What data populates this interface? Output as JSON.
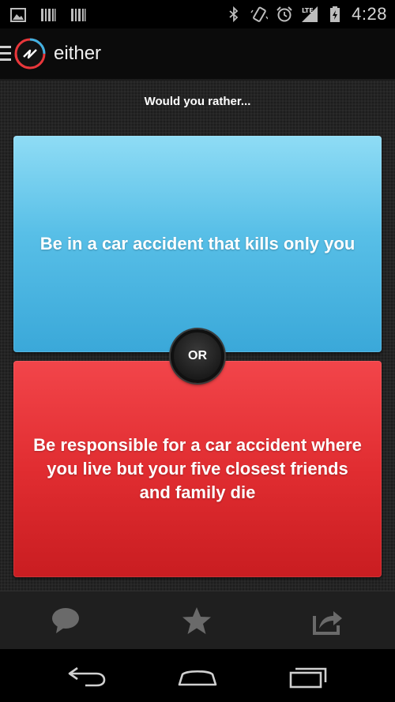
{
  "status_bar": {
    "time": "4:28",
    "left_icons": [
      "image-notification-icon",
      "barcode-notification-icon",
      "barcode-notification-icon"
    ],
    "right_icons": [
      "bluetooth-icon",
      "vibrate-icon",
      "alarm-icon",
      "lte-signal-icon",
      "battery-charging-icon"
    ],
    "network_label": "LTE"
  },
  "action_bar": {
    "title": "either",
    "logo_icon": "either-logo-icon",
    "menu_icon": "hamburger-menu-icon"
  },
  "content": {
    "prompt": "Would you rather...",
    "option_a": "Be in a car accident that kills only you",
    "option_b": "Be responsible for a car accident where you live but your five closest friends and family die",
    "or_label": "OR",
    "colors": {
      "option_a": "#58bfe7",
      "option_b": "#e12d31",
      "background": "#242424"
    }
  },
  "bottom_bar": {
    "icons": [
      "comment-icon",
      "star-icon",
      "share-icon"
    ]
  },
  "nav_bar": {
    "icons": [
      "back-icon",
      "home-icon",
      "recent-apps-icon"
    ]
  }
}
